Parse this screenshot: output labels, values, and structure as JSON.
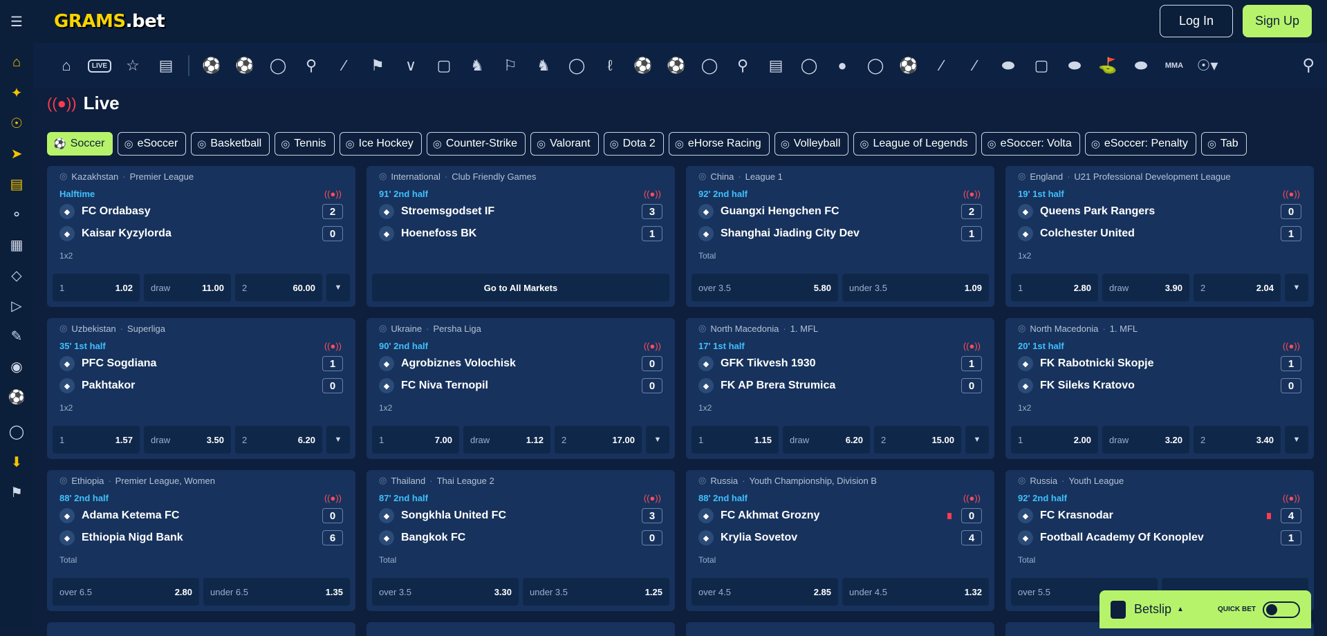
{
  "header": {
    "logo_main": "GRAMS",
    "logo_suffix": ".bet",
    "login": "Log In",
    "signup": "Sign Up"
  },
  "sidebar_icons": [
    "home-icon",
    "spinner-icon",
    "target-icon",
    "rocket-icon",
    "treasure-icon",
    "tag-icon",
    "gift-icon",
    "diamond-icon",
    "megaphone-icon",
    "ticket-icon",
    "headset-icon",
    "soccer-ball-icon",
    "chat-icon",
    "download-icon",
    "flag-uk-icon"
  ],
  "sports_icons": [
    "soccer-icon",
    "esoccer-icon",
    "basketball-icon",
    "tennis-icon",
    "ice-hockey-icon",
    "counter-strike-icon",
    "valorant-icon",
    "dota-icon",
    "horse-racing-icon",
    "racing-flag-icon",
    "ehorse-icon",
    "volleyball-icon",
    "lol-icon",
    "volta-icon",
    "penalty-icon",
    "table-tennis-icon",
    "badminton-icon",
    "fifa-icon",
    "ebasketball-icon",
    "mma-bowl-icon",
    "ehockey-icon",
    "eblitz-icon",
    "cricket-icon",
    "hockey-stick-icon",
    "american-football-icon",
    "cyber-icon",
    "rugby-icon",
    "golf-icon",
    "rugby-ball-icon",
    "mma-icon",
    "more-icon"
  ],
  "live": {
    "title": "Live"
  },
  "filters": [
    "Soccer",
    "eSoccer",
    "Basketball",
    "Tennis",
    "Ice Hockey",
    "Counter-Strike",
    "Valorant",
    "Dota 2",
    "eHorse Racing",
    "Volleyball",
    "League of Legends",
    "eSoccer: Volta",
    "eSoccer: Penalty",
    "Tab"
  ],
  "matches": [
    {
      "country": "Kazakhstan",
      "league": "Premier League",
      "status": "Halftime",
      "home": "FC Ordabasy",
      "away": "Kaisar Kyzylorda",
      "hs": "2",
      "as": "0",
      "market": "1x2",
      "odds": [
        [
          "1",
          "1.02"
        ],
        [
          "draw",
          "11.00"
        ],
        [
          "2",
          "60.00"
        ]
      ],
      "more": true
    },
    {
      "country": "International",
      "league": "Club Friendly Games",
      "status": "91' 2nd half",
      "home": "Stroemsgodset IF",
      "away": "Hoenefoss BK",
      "hs": "3",
      "as": "1",
      "market": "",
      "goall": "Go to All Markets"
    },
    {
      "country": "China",
      "league": "League 1",
      "status": "92' 2nd half",
      "home": "Guangxi Hengchen FC",
      "away": "Shanghai Jiading City Dev",
      "hs": "2",
      "as": "1",
      "market": "Total",
      "odds": [
        [
          "over 3.5",
          "5.80"
        ],
        [
          "under 3.5",
          "1.09"
        ]
      ],
      "more": false
    },
    {
      "country": "England",
      "league": "U21 Professional Development League",
      "status": "19' 1st half",
      "home": "Queens Park Rangers",
      "away": "Colchester United",
      "hs": "0",
      "as": "1",
      "market": "1x2",
      "odds": [
        [
          "1",
          "2.80"
        ],
        [
          "draw",
          "3.90"
        ],
        [
          "2",
          "2.04"
        ]
      ],
      "more": true
    },
    {
      "country": "Uzbekistan",
      "league": "Superliga",
      "status": "35' 1st half",
      "home": "PFC Sogdiana",
      "away": "Pakhtakor",
      "hs": "1",
      "as": "0",
      "market": "1x2",
      "odds": [
        [
          "1",
          "1.57"
        ],
        [
          "draw",
          "3.50"
        ],
        [
          "2",
          "6.20"
        ]
      ],
      "more": true
    },
    {
      "country": "Ukraine",
      "league": "Persha Liga",
      "status": "90' 2nd half",
      "home": "Agrobiznes Volochisk",
      "away": "FC Niva Ternopil",
      "hs": "0",
      "as": "0",
      "market": "1x2",
      "odds": [
        [
          "1",
          "7.00"
        ],
        [
          "draw",
          "1.12"
        ],
        [
          "2",
          "17.00"
        ]
      ],
      "more": true
    },
    {
      "country": "North Macedonia",
      "league": "1. MFL",
      "status": "17' 1st half",
      "home": "GFK Tikvesh 1930",
      "away": "FK AP Brera Strumica",
      "hs": "1",
      "as": "0",
      "market": "1x2",
      "odds": [
        [
          "1",
          "1.15"
        ],
        [
          "draw",
          "6.20"
        ],
        [
          "2",
          "15.00"
        ]
      ],
      "more": true
    },
    {
      "country": "North Macedonia",
      "league": "1. MFL",
      "status": "20' 1st half",
      "home": "FK Rabotnicki Skopje",
      "away": "FK Sileks Kratovo",
      "hs": "1",
      "as": "0",
      "market": "1x2",
      "odds": [
        [
          "1",
          "2.00"
        ],
        [
          "draw",
          "3.20"
        ],
        [
          "2",
          "3.40"
        ]
      ],
      "more": true
    },
    {
      "country": "Ethiopia",
      "league": "Premier League, Women",
      "status": "88' 2nd half",
      "home": "Adama Ketema FC",
      "away": "Ethiopia Nigd Bank",
      "hs": "0",
      "as": "6",
      "market": "Total",
      "odds": [
        [
          "over 6.5",
          "2.80"
        ],
        [
          "under 6.5",
          "1.35"
        ]
      ],
      "more": false
    },
    {
      "country": "Thailand",
      "league": "Thai League 2",
      "status": "87' 2nd half",
      "home": "Songkhla United FC",
      "away": "Bangkok FC",
      "hs": "3",
      "as": "0",
      "market": "Total",
      "odds": [
        [
          "over 3.5",
          "3.30"
        ],
        [
          "under 3.5",
          "1.25"
        ]
      ],
      "more": false
    },
    {
      "country": "Russia",
      "league": "Youth Championship, Division B",
      "status": "88' 2nd half",
      "home": "FC Akhmat Grozny",
      "away": "Krylia Sovetov",
      "hs": "0",
      "as": "4",
      "market": "Total",
      "odds": [
        [
          "over 4.5",
          "2.85"
        ],
        [
          "under 4.5",
          "1.32"
        ]
      ],
      "more": false,
      "redcard": true
    },
    {
      "country": "Russia",
      "league": "Youth League",
      "status": "92' 2nd half",
      "home": "FC Krasnodar",
      "away": "Football Academy Of Konoplev",
      "hs": "4",
      "as": "1",
      "market": "Total",
      "odds": [
        [
          "over 5.5",
          ""
        ],
        [
          "",
          ""
        ]
      ],
      "more": false,
      "redcard": true
    }
  ],
  "betslip": {
    "label": "Betslip",
    "quick_bet": "QUICK BET"
  },
  "colors": {
    "accent": "#b6f36b",
    "bg": "#0d1f3c",
    "card": "#17325c",
    "live": "#ff3b4d",
    "status": "#3fc1ff"
  }
}
